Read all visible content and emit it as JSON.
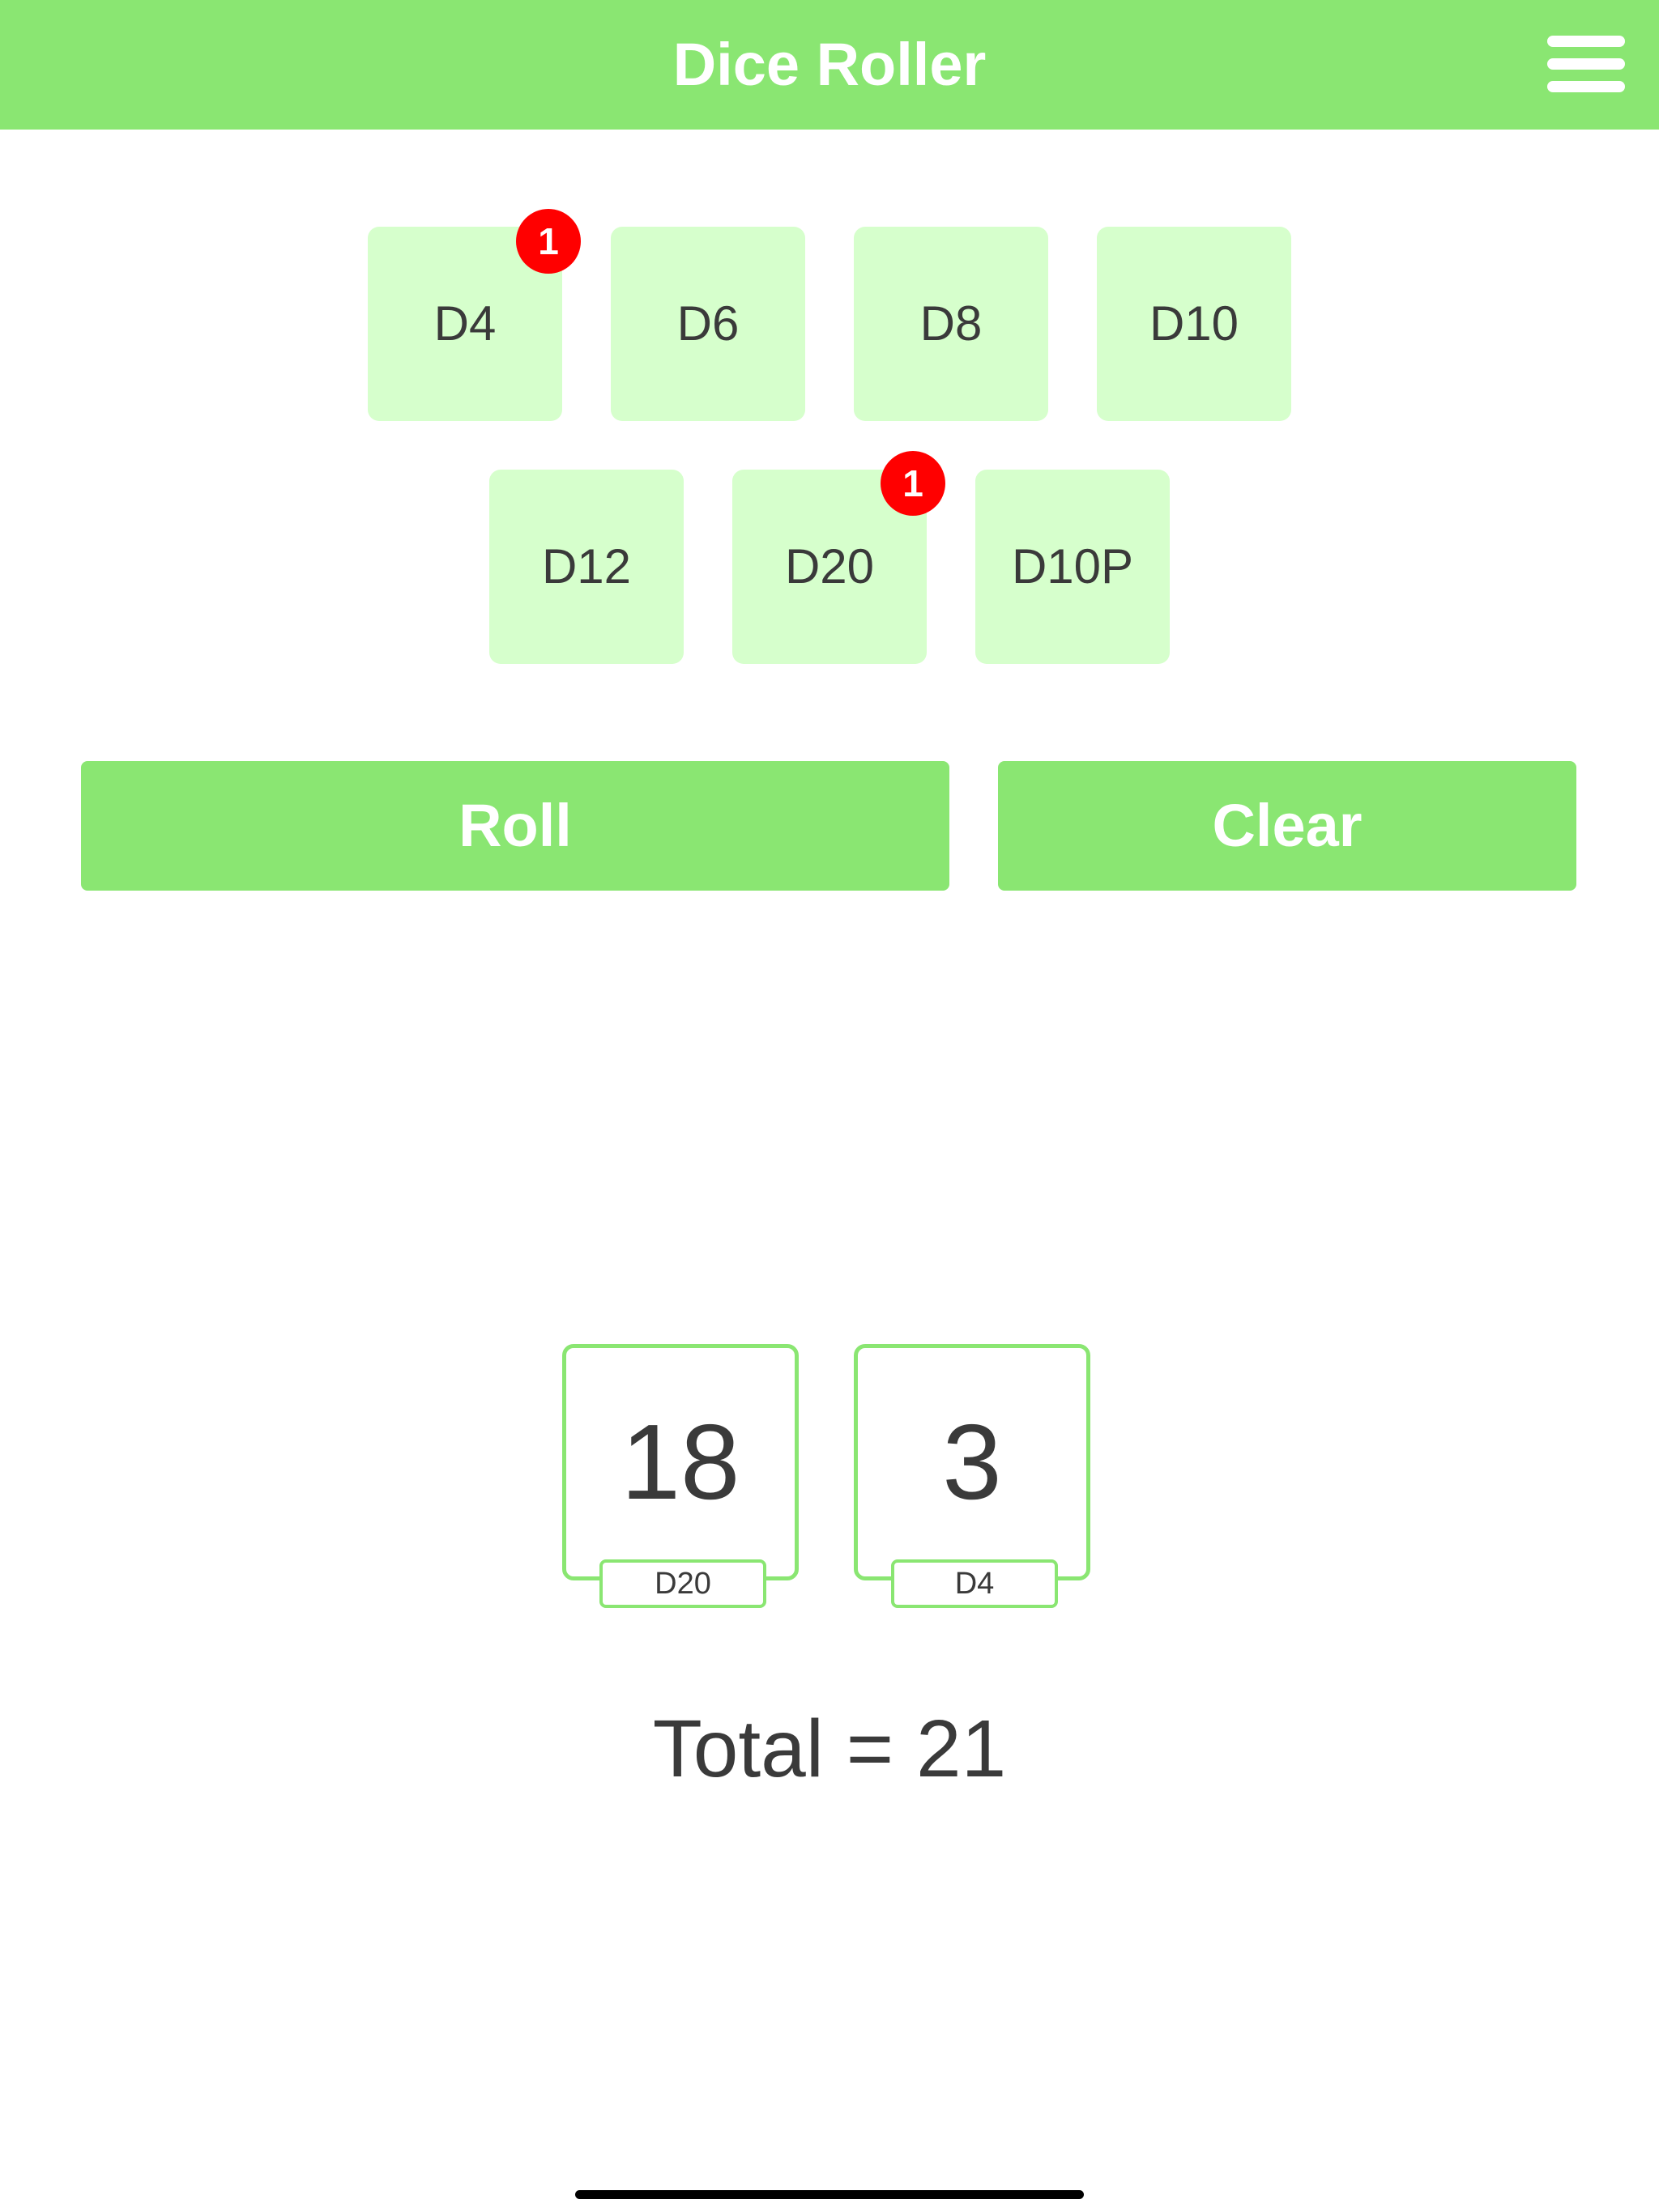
{
  "header": {
    "title": "Dice Roller",
    "menu_icon": "hamburger-menu-icon"
  },
  "dice": {
    "row1": [
      {
        "label": "D4",
        "badge": "1"
      },
      {
        "label": "D6"
      },
      {
        "label": "D8"
      },
      {
        "label": "D10"
      }
    ],
    "row2": [
      {
        "label": "D12"
      },
      {
        "label": "D20",
        "badge": "1"
      },
      {
        "label": "D10P"
      }
    ]
  },
  "actions": {
    "roll_label": "Roll",
    "clear_label": "Clear"
  },
  "results": [
    {
      "value": "18",
      "die": "D20"
    },
    {
      "value": "3",
      "die": "D4"
    }
  ],
  "total_text": "Total = 21",
  "colors": {
    "accent": "#8ae672",
    "die_bg": "#d6ffcc",
    "badge": "#ff0000",
    "text": "#3a3a3a"
  }
}
